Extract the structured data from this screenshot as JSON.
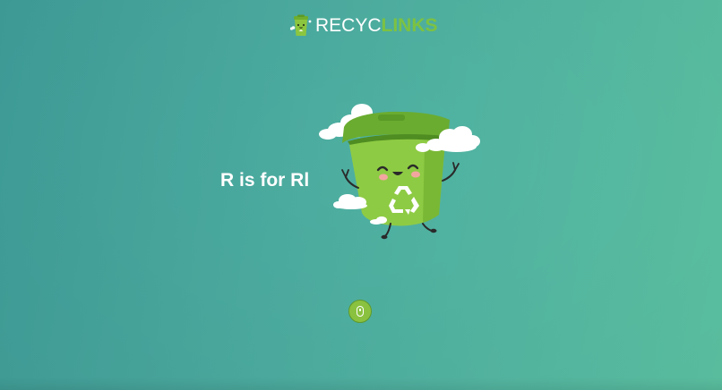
{
  "logo": {
    "part1": "RECYC",
    "part2": "LINKS",
    "icon": "recycle-bin-mascot-icon"
  },
  "hero": {
    "text": "R is for Rl"
  },
  "mascot": {
    "icon": "recycle-bin-mascot-illustration"
  },
  "scroll": {
    "icon": "mouse-scroll-icon"
  },
  "colors": {
    "background_start": "#3f9e99",
    "background_end": "#5cc3a3",
    "brand_green": "#7cc242",
    "text_white": "#ffffff"
  }
}
